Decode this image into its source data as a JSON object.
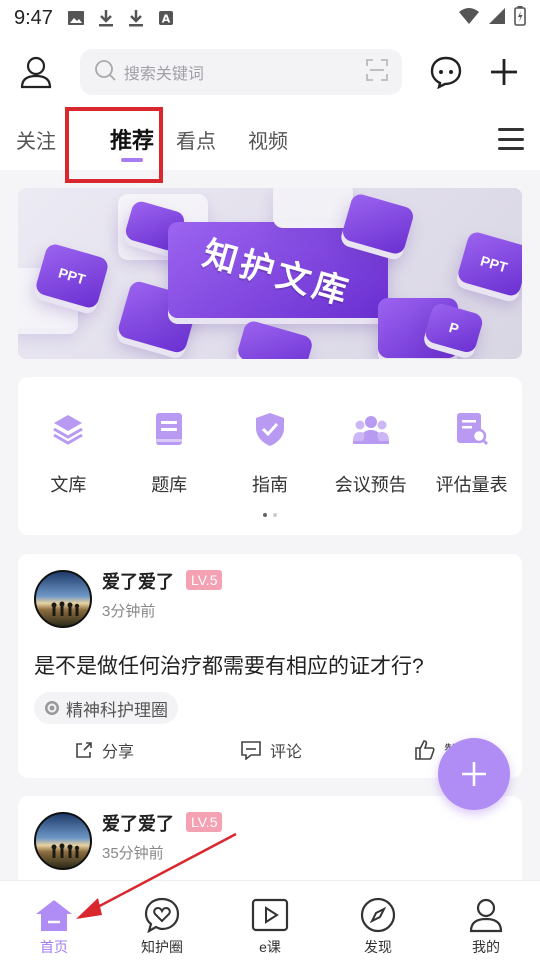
{
  "status_bar": {
    "time": "9:47",
    "icons": [
      "image-icon",
      "download-icon",
      "download-icon",
      "app-a-icon"
    ],
    "right_icons": [
      "wifi-icon",
      "signal-icon",
      "battery-charging-icon"
    ]
  },
  "header": {
    "search_placeholder": "搜索关键词",
    "icons": [
      "user-icon",
      "search-icon",
      "scan-icon",
      "chat-icon",
      "plus-icon"
    ]
  },
  "tabs": [
    {
      "label": "关注"
    },
    {
      "label": "推荐",
      "active": true
    },
    {
      "label": "看点"
    },
    {
      "label": "视频"
    }
  ],
  "banner": {
    "title": "知护文库",
    "keys": [
      "PPT",
      "PPT",
      "P"
    ]
  },
  "quick_nav": [
    {
      "label": "文库",
      "icon": "layers-icon"
    },
    {
      "label": "题库",
      "icon": "book-icon"
    },
    {
      "label": "指南",
      "icon": "shield-check-icon"
    },
    {
      "label": "会议预告",
      "icon": "group-icon"
    },
    {
      "label": "评估量表",
      "icon": "document-search-icon"
    }
  ],
  "posts": [
    {
      "author": "爱了爱了",
      "level": "LV.5",
      "time": "3分钟前",
      "text": "是不是做任何治疗都需要有相应的证才行?",
      "tag": "精神科护理圈",
      "actions": {
        "share": "分享",
        "comment": "评论",
        "like": "赞"
      }
    },
    {
      "author": "爱了爱了",
      "level": "LV.5",
      "time": "35分钟前"
    }
  ],
  "bottom_nav": [
    {
      "label": "首页",
      "icon": "home-icon",
      "active": true
    },
    {
      "label": "知护圈",
      "icon": "heart-chat-icon"
    },
    {
      "label": "e课",
      "icon": "play-icon"
    },
    {
      "label": "发现",
      "icon": "compass-icon"
    },
    {
      "label": "我的",
      "icon": "profile-icon"
    }
  ],
  "colors": {
    "accent": "#a67cf0",
    "badge": "#f4a1b4",
    "annotation": "#d9272e"
  }
}
